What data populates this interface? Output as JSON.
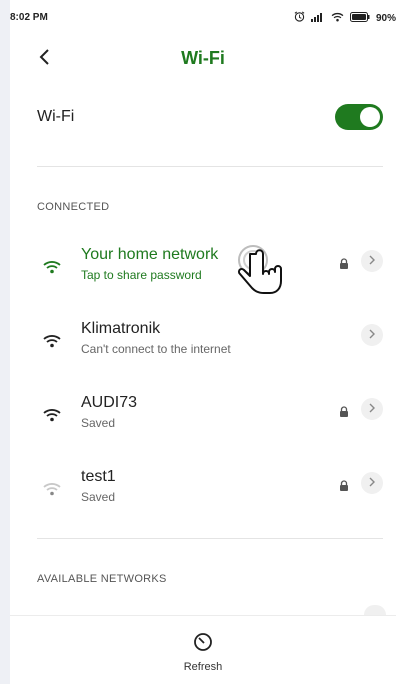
{
  "status_bar": {
    "time": "8:02 PM",
    "battery_percent": "90%",
    "icons": [
      "alarm-icon",
      "signal-icon",
      "wifi-icon",
      "battery-icon"
    ]
  },
  "header": {
    "back_icon": "chevron-left-icon",
    "title": "Wi-Fi"
  },
  "wifi_toggle": {
    "label": "Wi-Fi",
    "state": "on"
  },
  "sections": {
    "connected": "CONNECTED",
    "available": "AVAILABLE NETWORKS"
  },
  "networks": [
    {
      "name": "Your home network",
      "subtitle": "Tap to share password",
      "locked": true,
      "active": true,
      "signal": "strong"
    },
    {
      "name": "Klimatronik",
      "subtitle": "Can't connect to the internet",
      "locked": false,
      "active": false,
      "signal": "strong"
    },
    {
      "name": "AUDI73",
      "subtitle": "Saved",
      "locked": true,
      "active": false,
      "signal": "strong"
    },
    {
      "name": "test1",
      "subtitle": "Saved",
      "locked": true,
      "active": false,
      "signal": "weak"
    }
  ],
  "bottom_bar": {
    "refresh_label": "Refresh",
    "refresh_icon": "refresh-icon"
  },
  "colors": {
    "accent": "#1f7a1f",
    "text": "#222222",
    "muted": "#666666"
  }
}
